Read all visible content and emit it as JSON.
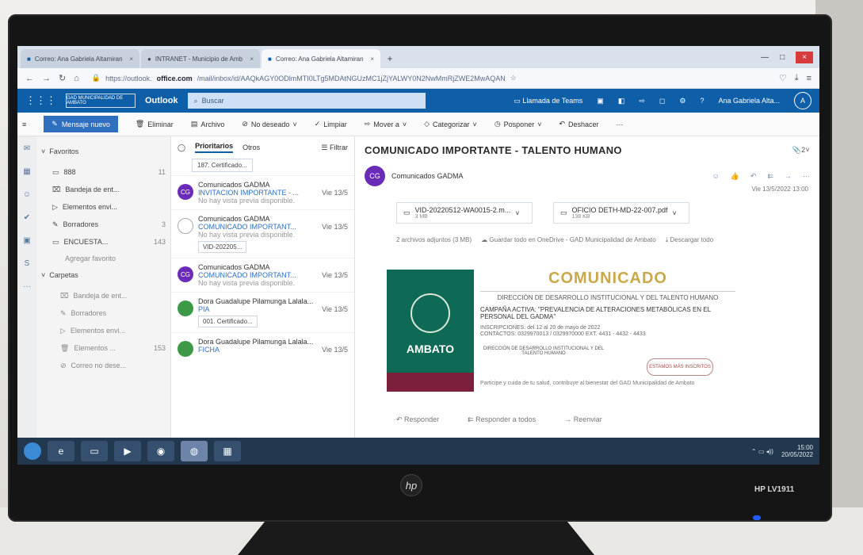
{
  "browser": {
    "tabs": [
      {
        "label": "Correo: Ana Gabriela Altamiran",
        "active": false
      },
      {
        "label": "INTRANET - Municipio de Amb",
        "active": false
      },
      {
        "label": "Correo: Ana Gabriela Altamiran",
        "active": true
      }
    ],
    "url_prefix": "https://outlook.",
    "url_domain": "office.com",
    "url_path": "/mail/inbox/id/AAQkAGY0ODlmMTI0LTg5MDAtNGUzMC1jZjYALWY0N2NwMmRjZWE2MwAQAN"
  },
  "owa": {
    "org_logo": "GAD MUNICIPALIDAD DE AMBATO",
    "app_name": "Outlook",
    "search_placeholder": "Buscar",
    "teams_call": "Llamada de Teams",
    "user_name": "Ana Gabriela Alta...",
    "avatar_initials": "A"
  },
  "ribbon": {
    "new_message": "Mensaje nuevo",
    "delete": "Eliminar",
    "archive": "Archivo",
    "junk": "No deseado",
    "sweep": "Limpiar",
    "move": "Mover a",
    "categorize": "Categorizar",
    "snooze": "Posponer",
    "undo": "Deshacer"
  },
  "folders": {
    "favorites_label": "Favoritos",
    "items": [
      {
        "label": "888",
        "count": "11"
      },
      {
        "label": "Bandeja de ent...",
        "count": ""
      },
      {
        "label": "Elementos envi...",
        "count": ""
      },
      {
        "label": "Borradores",
        "count": "3"
      },
      {
        "label": "ENCUESTA...",
        "count": "143"
      }
    ],
    "add_favorite": "Agregar favorito",
    "folders_label": "Carpetas",
    "sub_items": [
      {
        "label": "Bandeja de ent..."
      },
      {
        "label": "Borradores"
      },
      {
        "label": "Elementos envi..."
      },
      {
        "label": "Elementos ...",
        "count": "153"
      },
      {
        "label": "Correo no dese..."
      }
    ]
  },
  "message_list": {
    "focused_tab": "Prioritarios",
    "other_tab": "Otros",
    "filter_label": "Filtrar",
    "top_chip": "187. Certificado...",
    "messages": [
      {
        "avatar": "CG",
        "color": "#6a2cb8",
        "sender": "Comunicados GADMA",
        "subject": "INVITACION IMPORTANTE - ...",
        "date": "Vie 13/5",
        "preview": "No hay vista previa disponible.",
        "attachment": ""
      },
      {
        "avatar": "",
        "color": "radio",
        "sender": "Comunicados GADMA",
        "subject": "COMUNICADO IMPORTANT...",
        "date": "Vie 13/5",
        "preview": "No hay vista previa disponible.",
        "attachment": "VID-202205..."
      },
      {
        "avatar": "CG",
        "color": "#6a2cb8",
        "sender": "Comunicados GADMA",
        "subject": "COMUNICADO IMPORTANT...",
        "date": "Vie 13/5",
        "preview": "No hay vista previa disponible.",
        "attachment": ""
      },
      {
        "avatar": "",
        "color": "#3c9a46",
        "sender": "Dora Guadalupe Pilamunga Lalala...",
        "subject": "PIA",
        "date": "Vie 13/5",
        "preview": "",
        "attachment": "001. Certificado..."
      },
      {
        "avatar": "",
        "color": "#3c9a46",
        "sender": "Dora Guadalupe Pilamunga Lalala...",
        "subject": "FICHA",
        "date": "Vie 13/5",
        "preview": "",
        "attachment": ""
      }
    ]
  },
  "reading": {
    "subject": "COMUNICADO IMPORTANTE - TALENTO HUMANO",
    "count_badge": "2",
    "sender_initials": "CG",
    "sender_name": "Comunicados GADMA",
    "date": "Vie 13/5/2022 13:00",
    "attachments": [
      {
        "name": "VID-20220512-WA0015-2.m...",
        "size": "3 MB"
      },
      {
        "name": "OFICIO DETH-MD-22-007.pdf",
        "size": "138 KB"
      }
    ],
    "attachments_info": "2 archivos adjuntos (3 MB)",
    "save_onedrive": "Guardar todo en OneDrive - GAD Municipalidad de Ambato",
    "download_all": "Descargar todo",
    "poster_brand": "AMBATO",
    "poster_title": "COMUNICADO",
    "poster_dept": "DIRECCIÓN DE DESARROLLO INSTITUCIONAL Y DEL TALENTO HUMANO",
    "poster_campaign": "CAMPAÑA ACTIVA: \"PREVALENCIA DE ALTERACIONES METABÓLICAS EN EL PERSONAL DEL GADMA\"",
    "poster_dates": "INSCRIPCIONES: del 12 al 20 de mayo de 2022",
    "poster_contact": "CONTACTOS: 0329970013 / 0329970000 EXT. 4431 - 4432 - 4433",
    "poster_sign": "DIRECCIÓN DE DESARROLLO INSTITUCIONAL Y DEL TALENTO HUMANO",
    "poster_seal": "ESTAMOS MÁS INSCRITOS",
    "poster_footer": "Participe y cuida de tu salud, contribuye al bienestar del GAD Municipalidad de Ambato",
    "reply": "Responder",
    "reply_all": "Responder a todos",
    "forward": "Reenviar"
  },
  "taskbar": {
    "time": "15:00",
    "date": "20/05/2022"
  },
  "monitor": {
    "brand": "hp",
    "model": "HP LV1911"
  }
}
